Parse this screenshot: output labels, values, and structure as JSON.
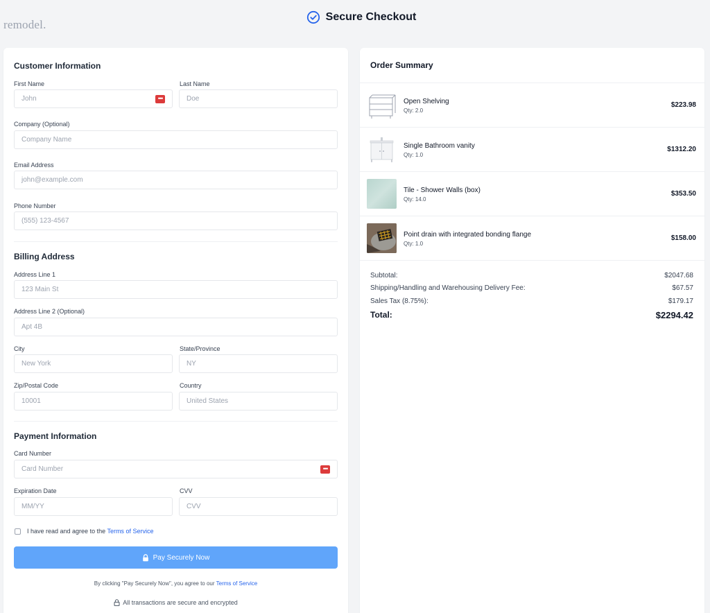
{
  "brand": {
    "logo_text": "remodel."
  },
  "header": {
    "title": "Secure Checkout"
  },
  "customer": {
    "section_title": "Customer Information",
    "first_name": {
      "label": "First Name",
      "placeholder": "John"
    },
    "last_name": {
      "label": "Last Name",
      "placeholder": "Doe"
    },
    "company": {
      "label": "Company (Optional)",
      "placeholder": "Company Name"
    },
    "email": {
      "label": "Email Address",
      "placeholder": "john@example.com"
    },
    "phone": {
      "label": "Phone Number",
      "placeholder": "(555) 123-4567"
    }
  },
  "billing": {
    "section_title": "Billing Address",
    "address1": {
      "label": "Address Line 1",
      "placeholder": "123 Main St"
    },
    "address2": {
      "label": "Address Line 2 (Optional)",
      "placeholder": "Apt 4B"
    },
    "city": {
      "label": "City",
      "placeholder": "New York"
    },
    "state": {
      "label": "State/Province",
      "placeholder": "NY"
    },
    "zip": {
      "label": "Zip/Postal Code",
      "placeholder": "10001"
    },
    "country": {
      "label": "Country",
      "placeholder": "United States"
    }
  },
  "payment": {
    "section_title": "Payment Information",
    "card_number": {
      "label": "Card Number",
      "placeholder": "Card Number"
    },
    "expiration": {
      "label": "Expiration Date",
      "placeholder": "MM/YY"
    },
    "cvv": {
      "label": "CVV",
      "placeholder": "CVV"
    }
  },
  "terms": {
    "agree_prefix": "I have read and agree to the ",
    "terms_link": "Terms of Service"
  },
  "pay_button": {
    "label": "Pay Securely Now"
  },
  "fine_print": {
    "prefix": "By clicking \"Pay Securely Now\", you agree to our ",
    "link": "Terms of Service"
  },
  "secure_note": "All transactions are secure and encrypted",
  "summary": {
    "title": "Order Summary",
    "items": [
      {
        "name": "Open Shelving",
        "qty": "Qty: 2.0",
        "price": "$223.98",
        "thumb_icon": "shelving-product-image"
      },
      {
        "name": "Single Bathroom vanity",
        "qty": "Qty: 1.0",
        "price": "$1312.20",
        "thumb_icon": "vanity-product-image"
      },
      {
        "name": "Tile - Shower Walls (box)",
        "qty": "Qty: 14.0",
        "price": "$353.50",
        "thumb_icon": "tile-product-image"
      },
      {
        "name": "Point drain with integrated bonding flange",
        "qty": "Qty: 1.0",
        "price": "$158.00",
        "thumb_icon": "drain-product-image"
      }
    ],
    "subtotal_label": "Subtotal:",
    "subtotal": "$2047.68",
    "shipping_label": "Shipping/Handling and Warehousing Delivery Fee:",
    "shipping": "$67.57",
    "tax_label": "Sales Tax (8.75%):",
    "tax": "$179.17",
    "total_label": "Total:",
    "total": "$2294.42"
  },
  "colors": {
    "accent": "#2563eb",
    "pay_button": "#60a5fa",
    "autofill_badge": "#dc3b3b",
    "background": "#f3f4f6"
  }
}
